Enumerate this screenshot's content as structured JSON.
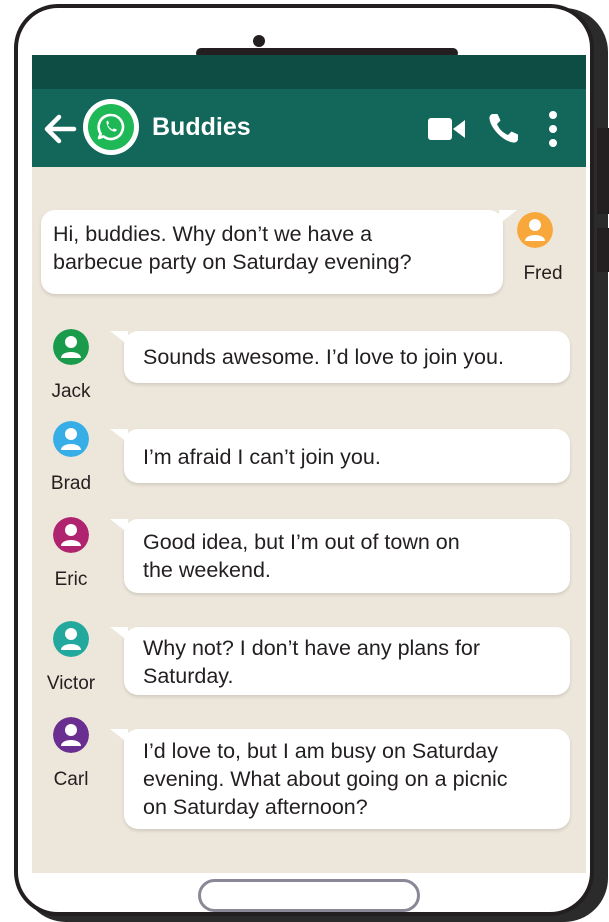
{
  "header": {
    "title": "Buddies"
  },
  "messages": [
    {
      "sender": "Fred",
      "side": "right",
      "color": "#f8a73a",
      "text_lines": [
        "Hi, buddies. Why don’t we have a",
        "barbecue party on Saturday evening?"
      ]
    },
    {
      "sender": "Jack",
      "side": "left",
      "color": "#1a9a4b",
      "text_lines": [
        "Sounds awesome. I’d love to join you."
      ]
    },
    {
      "sender": "Brad",
      "side": "left",
      "color": "#37aee5",
      "text_lines": [
        "I’m afraid I can’t join you."
      ]
    },
    {
      "sender": "Eric",
      "side": "left",
      "color": "#b0246f",
      "text_lines": [
        "Good idea, but I’m out of town on",
        "the weekend."
      ]
    },
    {
      "sender": "Victor",
      "side": "left",
      "color": "#22a89c",
      "text_lines": [
        "Why not? I don’t have any plans for",
        "Saturday."
      ]
    },
    {
      "sender": "Carl",
      "side": "left",
      "color": "#6a2d90",
      "text_lines": [
        "I’d love to, but I am busy on Saturday",
        "evening. What about going on a picnic",
        "on Saturday afternoon?"
      ]
    }
  ],
  "colors": {
    "header": "#12675a",
    "status_bar": "#0e4d43",
    "chat_background": "#ede6da",
    "whatsapp_green": "#1fb857"
  },
  "icons": [
    "back-arrow-icon",
    "whatsapp-icon",
    "video-call-icon",
    "phone-call-icon",
    "more-options-icon",
    "person-icon"
  ]
}
